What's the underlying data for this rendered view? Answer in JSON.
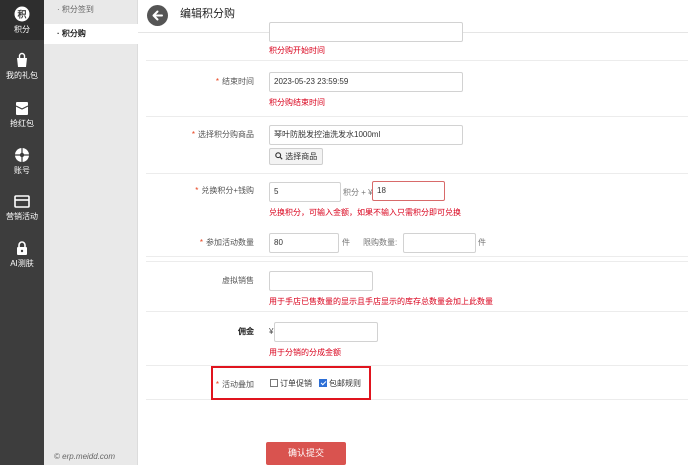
{
  "iconbar": {
    "items": [
      {
        "label": "积分",
        "icon": "points-icon",
        "active": true
      },
      {
        "label": "我的礼包",
        "icon": "gift-bag-icon"
      },
      {
        "label": "抢红包",
        "icon": "red-packet-icon"
      },
      {
        "label": "账号",
        "icon": "account-icon"
      },
      {
        "label": "营销活动",
        "icon": "marketing-icon"
      },
      {
        "label": "AI测肤",
        "icon": "ai-skin-test-icon"
      }
    ]
  },
  "subnav": {
    "items": [
      {
        "label": "· 积分签到"
      },
      {
        "label": "· 积分购",
        "active": true
      }
    ],
    "copyright": "© erp.meidd.com"
  },
  "header": {
    "title": "编辑积分购"
  },
  "form": {
    "start_time_hint": "积分购开始时间",
    "end_time": {
      "label": "结束时间",
      "value": "2023-05-23 23:59:59",
      "hint": "积分购结束时间"
    },
    "product": {
      "label": "选择积分购商品",
      "value": "琴叶防脱发控油洗发水1000ml",
      "button": "选择商品"
    },
    "exchange": {
      "label": "兑换积分+钱购",
      "points_value": "5",
      "points_unit": "积分 + ¥",
      "money_value": "18",
      "hint": "兑换积分，可输入金额，如果不输入只需积分即可兑换"
    },
    "participants": {
      "label": "参加活动数量",
      "value": "80",
      "unit": "件",
      "limit_label": "限购数量:",
      "limit_value": "",
      "limit_unit": "件"
    },
    "virtual_sales": {
      "label": "虚拟销售",
      "value": "",
      "hint": "用于手店已售数量的显示且手店显示的库存总数量会加上此数量"
    },
    "commission": {
      "label": "佣金",
      "prefix": "¥",
      "value": "",
      "hint": "用于分销的分成金额"
    },
    "stacking": {
      "label": "活动叠加",
      "option1": "订单促销",
      "option1_checked": false,
      "option2": "包邮规则",
      "option2_checked": true
    }
  },
  "submit_label": "确认提交",
  "colors": {
    "accent": "#d9534f",
    "required_star": "#e8421d",
    "hint_red": "#d9001b",
    "sidebar": "#3d3d3d"
  }
}
